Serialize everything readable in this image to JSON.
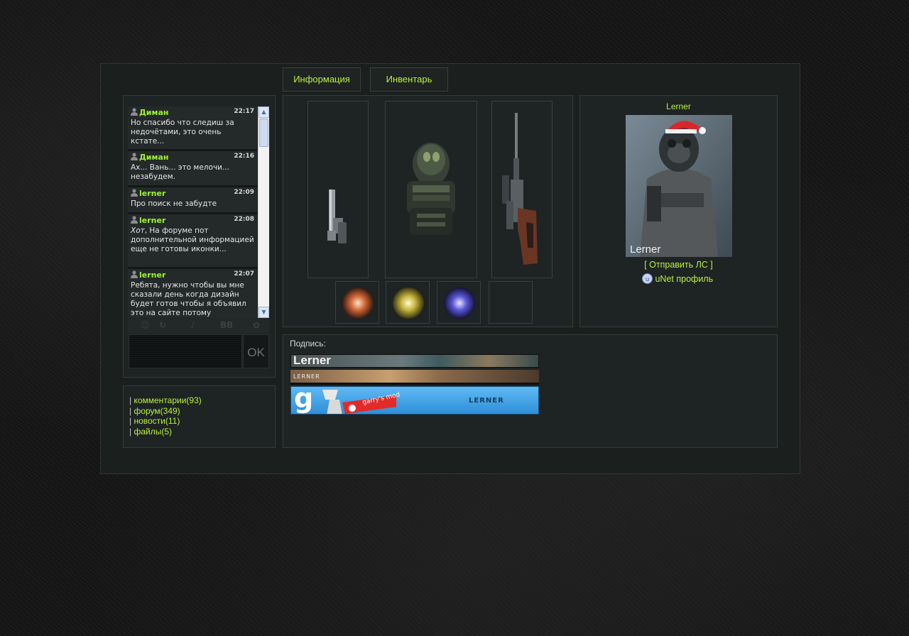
{
  "tabs": [
    {
      "label": "Информация"
    },
    {
      "label": "Инвентарь"
    }
  ],
  "chat": {
    "messages": [
      {
        "author": "Диман",
        "time": "22:17",
        "text": "Но спасибо что следиш за недочётами, это очень кстате..."
      },
      {
        "author": "Диман",
        "time": "22:16",
        "text": "Ах... Вань... это мелочи... незабудем."
      },
      {
        "author": "lerner",
        "time": "22:09",
        "text": "Про поиск не забудте"
      },
      {
        "author": "lerner",
        "time": "22:08",
        "text_em": "Хот",
        "text": ", На форуме пот дополнительной информацией еще не готовы иконки..."
      },
      {
        "author": "lerner",
        "time": "22:07",
        "text": "Ребята, нужно чтобы вы мне сказали день когда дизайн будет готов чтобы я объявил это на сайте потому"
      }
    ],
    "toolbar_icons": [
      "smile-icon",
      "refresh-icon",
      "sound-icon",
      "bbcode-icon",
      "settings-icon"
    ],
    "toolbar_bb": "BB",
    "ok_label": "OK"
  },
  "links": [
    {
      "prefix": "| ",
      "label": "комментарии(93)"
    },
    {
      "prefix": "| ",
      "label": "форум(349)"
    },
    {
      "prefix": "| ",
      "label": "новости(11)"
    },
    {
      "prefix": "| ",
      "label": "файлы(5)"
    }
  ],
  "inventory": {
    "slots": [
      "pistol",
      "armor-suit",
      "sniper-rifle"
    ],
    "artifacts": [
      "artifact-fire",
      "artifact-electric",
      "artifact-gravity",
      "empty"
    ]
  },
  "profile": {
    "username": "Lerner",
    "avatar_caption": "Lerner",
    "send_pm": "[ Отправить ЛС ]",
    "unet_profile": "uNet профиль"
  },
  "signature": {
    "label": "Подпись:",
    "banner1_text": "Lerner",
    "banner2_text": "LERNER",
    "banner3_text": "LERNER",
    "banner3_brand": "garry's mod",
    "banner3_g": "g"
  },
  "colors": {
    "accent": "#b8f040",
    "author": "#9df232",
    "panel_bg": "#1e2323",
    "border": "#353c3a"
  }
}
